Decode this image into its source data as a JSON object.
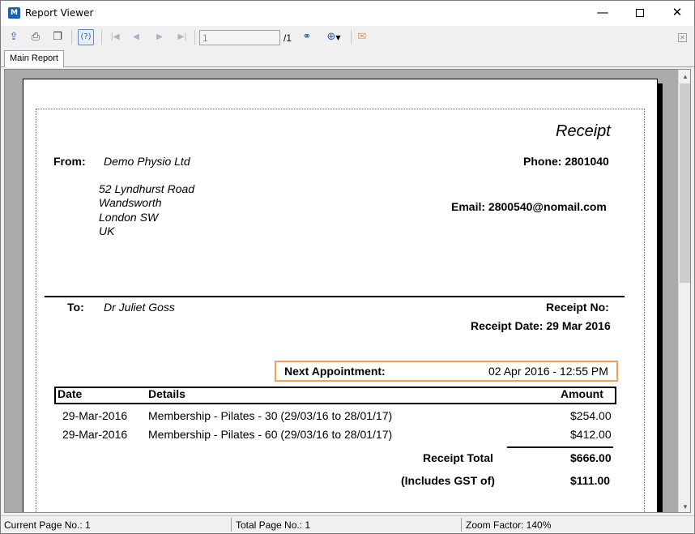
{
  "window": {
    "title": "Report Viewer",
    "app_icon": "M",
    "controls": {
      "minimize": "—",
      "close": "✕"
    }
  },
  "toolbar": {
    "page_input_value": "1",
    "page_total": "/1",
    "icons": [
      "export-icon",
      "print-icon",
      "copy-icon",
      "help-icon",
      "first-page-icon",
      "prev-page-icon",
      "next-page-icon",
      "last-page-icon",
      "find-icon",
      "zoom-icon",
      "email-icon",
      "close-icon"
    ]
  },
  "tabs": [
    {
      "label": "Main Report"
    }
  ],
  "report": {
    "title": "Receipt",
    "from_label": "From:",
    "from_name": "Demo Physio Ltd",
    "address": [
      "52 Lyndhurst Road",
      "Wandsworth",
      "London  SW",
      "UK"
    ],
    "phone": "Phone: 2801040",
    "email": "Email: 2800540@nomail.com",
    "to_label": "To:",
    "to_name": "Dr Juliet Goss",
    "receipt_no_label": "Receipt No:",
    "receipt_date": "Receipt Date: 29 Mar 2016",
    "next_appointment_label": "Next Appointment:",
    "next_appointment_value": "02 Apr 2016 - 12:55 PM",
    "table": {
      "headers": {
        "date": "Date",
        "details": "Details",
        "amount": "Amount"
      },
      "rows": [
        {
          "date": "29-Mar-2016",
          "details": "Membership - Pilates - 30 (29/03/16 to 28/01/17)",
          "amount": "$254.00"
        },
        {
          "date": "29-Mar-2016",
          "details": "Membership - Pilates - 60 (29/03/16 to 28/01/17)",
          "amount": "$412.00"
        }
      ]
    },
    "total_label": "Receipt Total",
    "total_value": "$666.00",
    "gst_label": "(Includes GST of)",
    "gst_value": "$111.00"
  },
  "status": {
    "current_page": "Current Page No.: 1",
    "total_page": "Total Page No.: 1",
    "zoom": "Zoom Factor: 140%"
  },
  "colors": {
    "highlight_border": "#f5a14a",
    "toolbar_icon": "#2a5ea8",
    "viewer_background": "#ababab"
  }
}
